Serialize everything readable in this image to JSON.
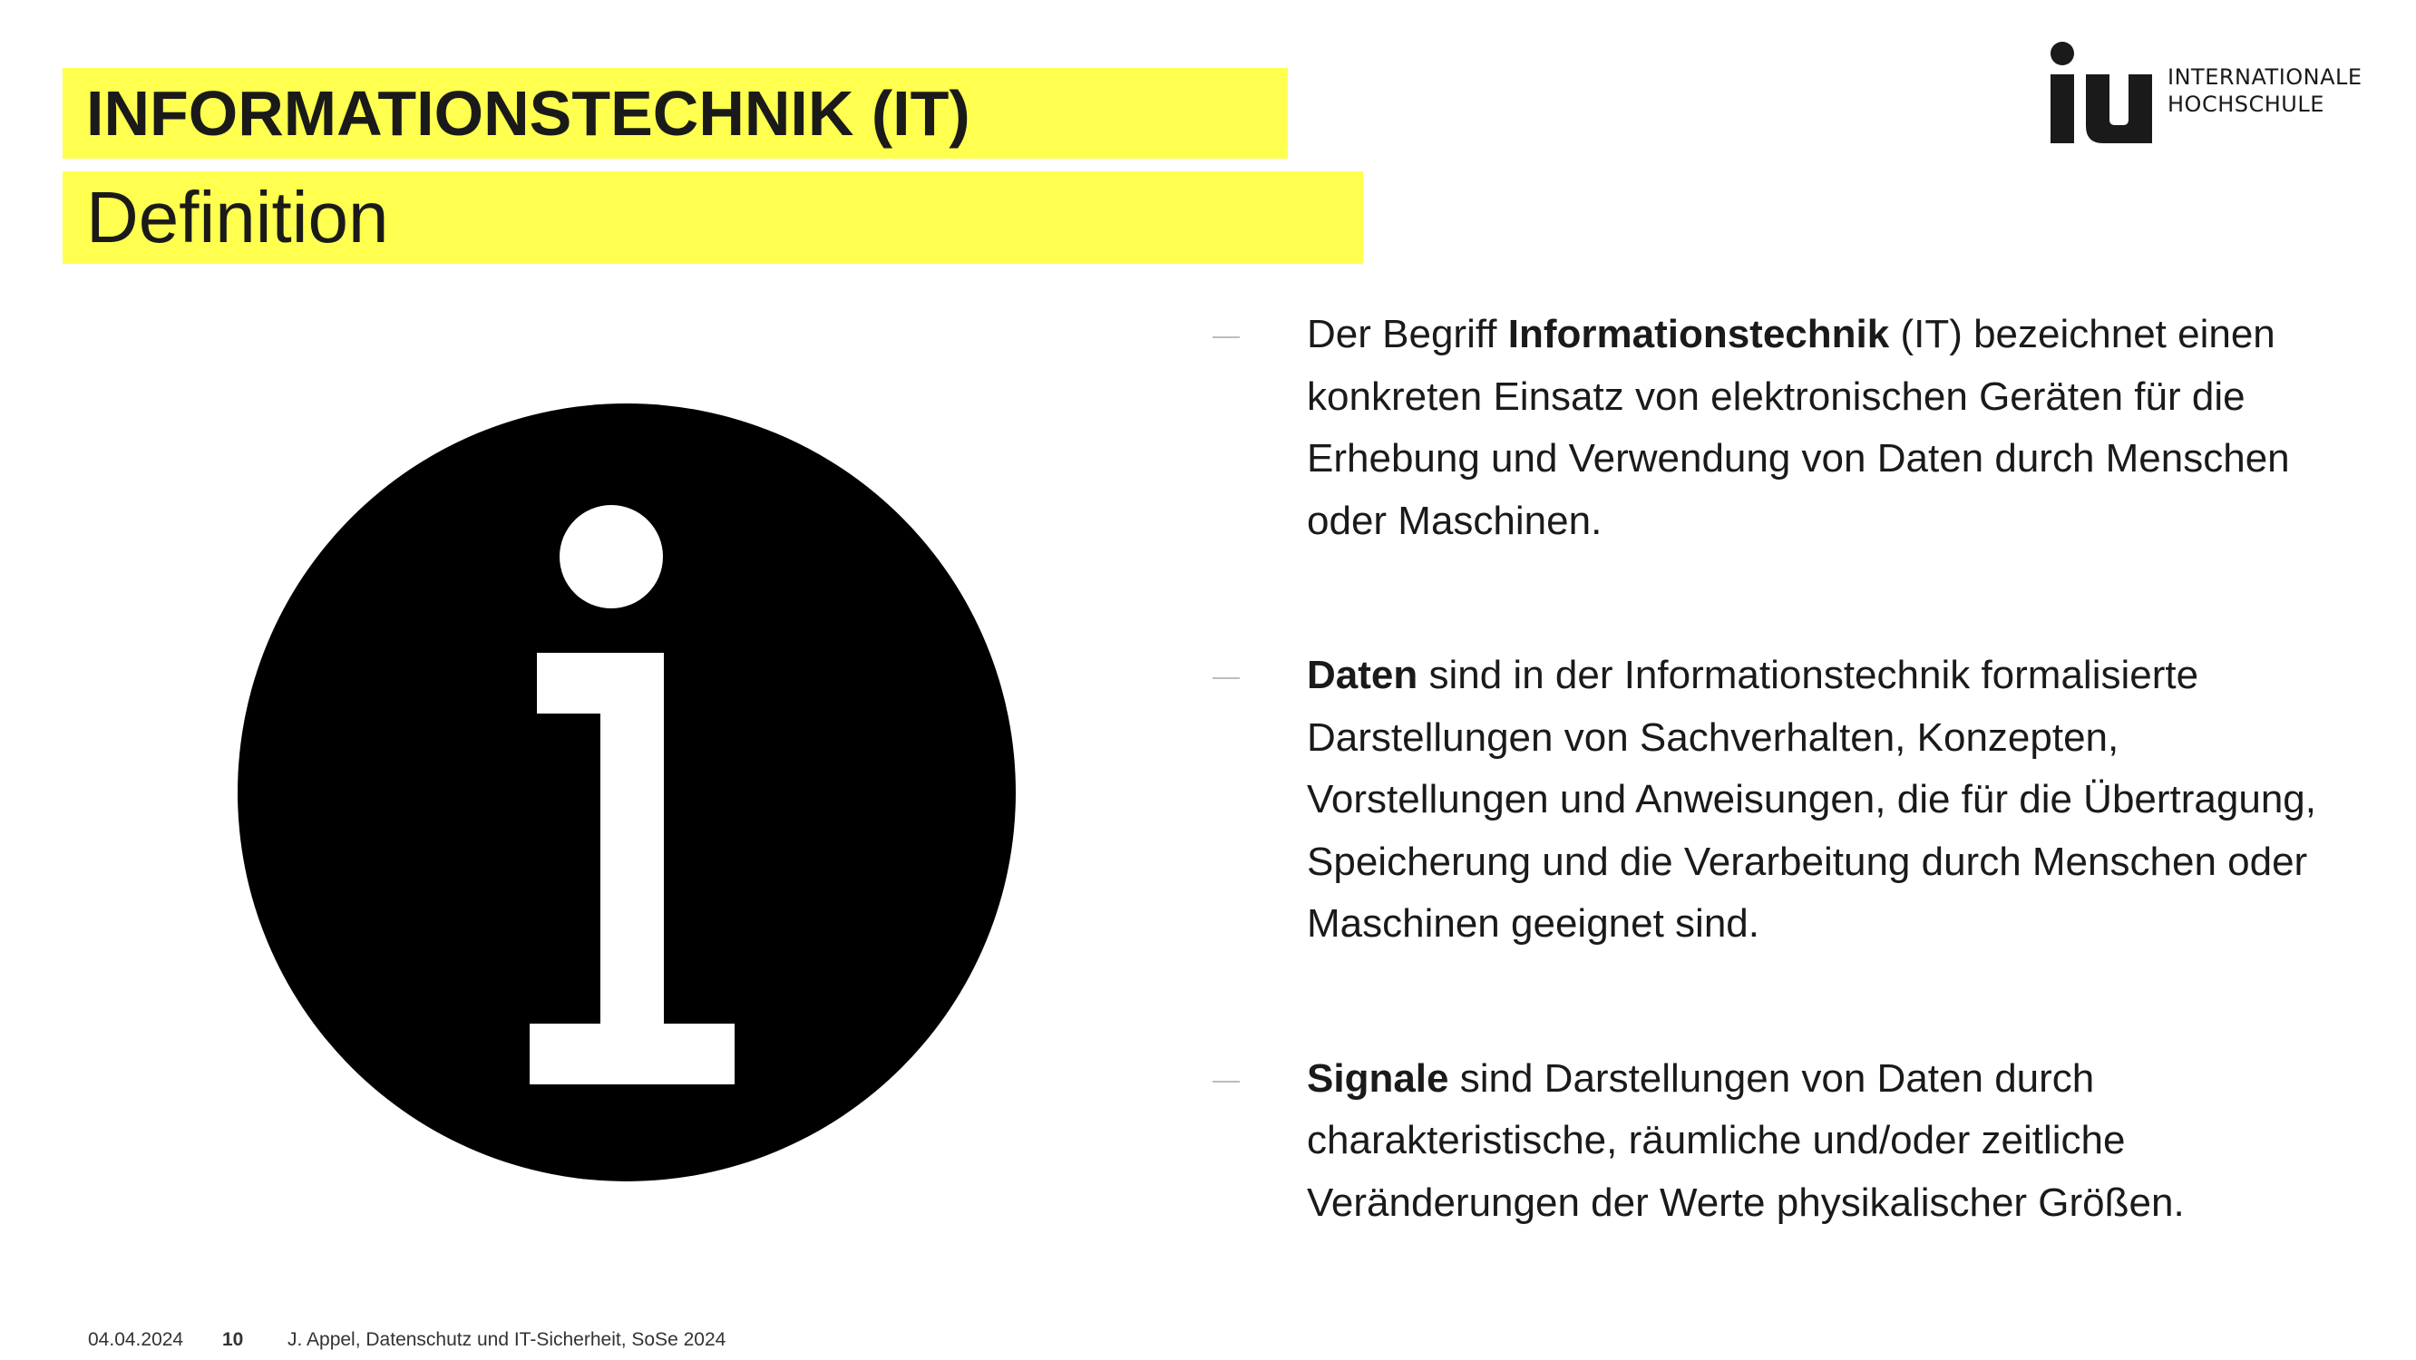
{
  "header": {
    "title": "INFORMATIONSTECHNIK (IT)",
    "subtitle": "Definition"
  },
  "logo": {
    "mark": "iu",
    "line1": "INTERNATIONALE",
    "line2": "HOCHSCHULE"
  },
  "icon": "info-icon",
  "bullets": [
    {
      "pre": "Der Begriff ",
      "bold": "Informationstechnik",
      "post": " (IT) bezeichnet einen konkreten Einsatz von elektronischen Geräten für die Erhebung und Verwendung von Daten durch Menschen oder Maschinen."
    },
    {
      "pre": "",
      "bold": "Daten",
      "post": " sind in der Informationstechnik formalisierte Darstellungen von Sachverhalten, Konzepten, Vorstellungen und Anweisungen, die für die Übertragung, Speicherung und die Verarbeitung durch Menschen oder Maschinen geeignet sind."
    },
    {
      "pre": "",
      "bold": "Signale",
      "post": " sind Darstellungen von Daten durch charakteristische, räumliche und/oder zeitliche Veränderungen der Werte physikalischer Größen."
    }
  ],
  "footer": {
    "date": "04.04.2024",
    "page": "10",
    "text": "J. Appel, Datenschutz und IT-Sicherheit, SoSe 2024"
  },
  "colors": {
    "highlight": "#ffff4f",
    "text": "#1a1a1a"
  }
}
